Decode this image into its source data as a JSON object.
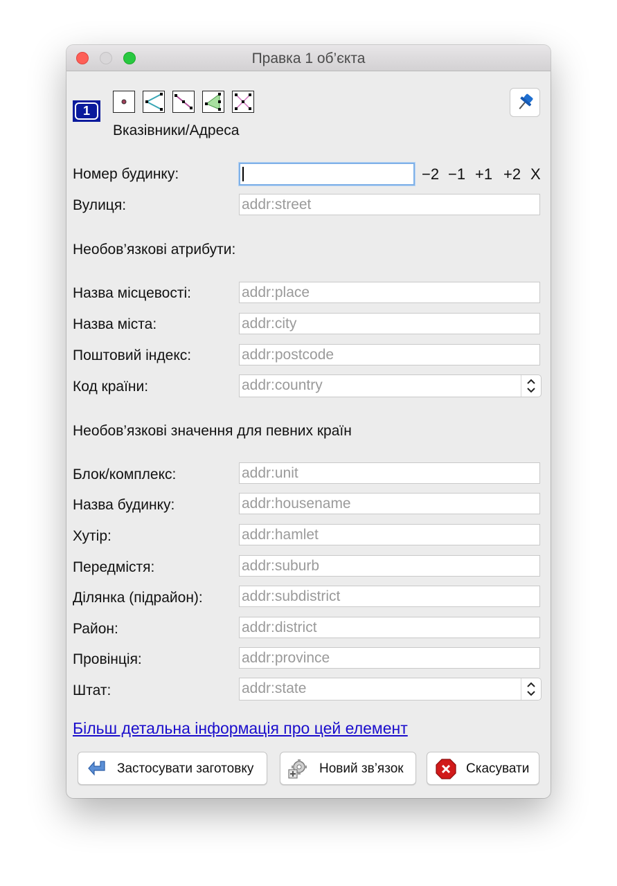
{
  "window": {
    "title": "Правка 1 об’єкта"
  },
  "header": {
    "count_badge": "1",
    "preset_name": "Вказівники/Адреса",
    "type_icons": [
      "node-type-icon",
      "way-type-icon",
      "closed-way-type-icon",
      "area-type-icon",
      "relation-type-icon"
    ]
  },
  "house_number": {
    "label": "Номер будинку:",
    "value": "",
    "adjust": [
      "−2",
      "−1",
      "+1",
      "+2",
      "X"
    ]
  },
  "street": {
    "label": "Вулиця:",
    "placeholder": "addr:street"
  },
  "optional_attributes": {
    "heading": "Необов’язкові атрибути:",
    "fields": [
      {
        "label": "Назва місцевості:",
        "placeholder": "addr:place"
      },
      {
        "label": "Назва міста:",
        "placeholder": "addr:city"
      },
      {
        "label": "Поштовий індекс:",
        "placeholder": "addr:postcode"
      },
      {
        "label": "Код країни:",
        "placeholder": "addr:country"
      }
    ]
  },
  "country_specific": {
    "heading": "Необов’язкові значення для певних країн",
    "fields": [
      {
        "label": "Блок/комплекс:",
        "placeholder": "addr:unit"
      },
      {
        "label": "Назва будинку:",
        "placeholder": "addr:housename"
      },
      {
        "label": "Хутір:",
        "placeholder": "addr:hamlet"
      },
      {
        "label": "Передмістя:",
        "placeholder": "addr:suburb"
      },
      {
        "label": "Ділянка (підрайон):",
        "placeholder": "addr:subdistrict"
      },
      {
        "label": "Район:",
        "placeholder": "addr:district"
      },
      {
        "label": "Провінція:",
        "placeholder": "addr:province"
      },
      {
        "label": "Штат:",
        "placeholder": "addr:state"
      }
    ]
  },
  "more_info_link": "Більш детальна інформація про цей елемент",
  "buttons": {
    "apply_preset": "Застосувати заготовку",
    "new_relation": "Новий зв’язок",
    "cancel": "Скасувати"
  },
  "colors": {
    "link": "#1a0dcc",
    "focus_ring": "#7fb1e8",
    "cancel_icon": "#d11a1a",
    "badge": "#0a1a9c"
  }
}
